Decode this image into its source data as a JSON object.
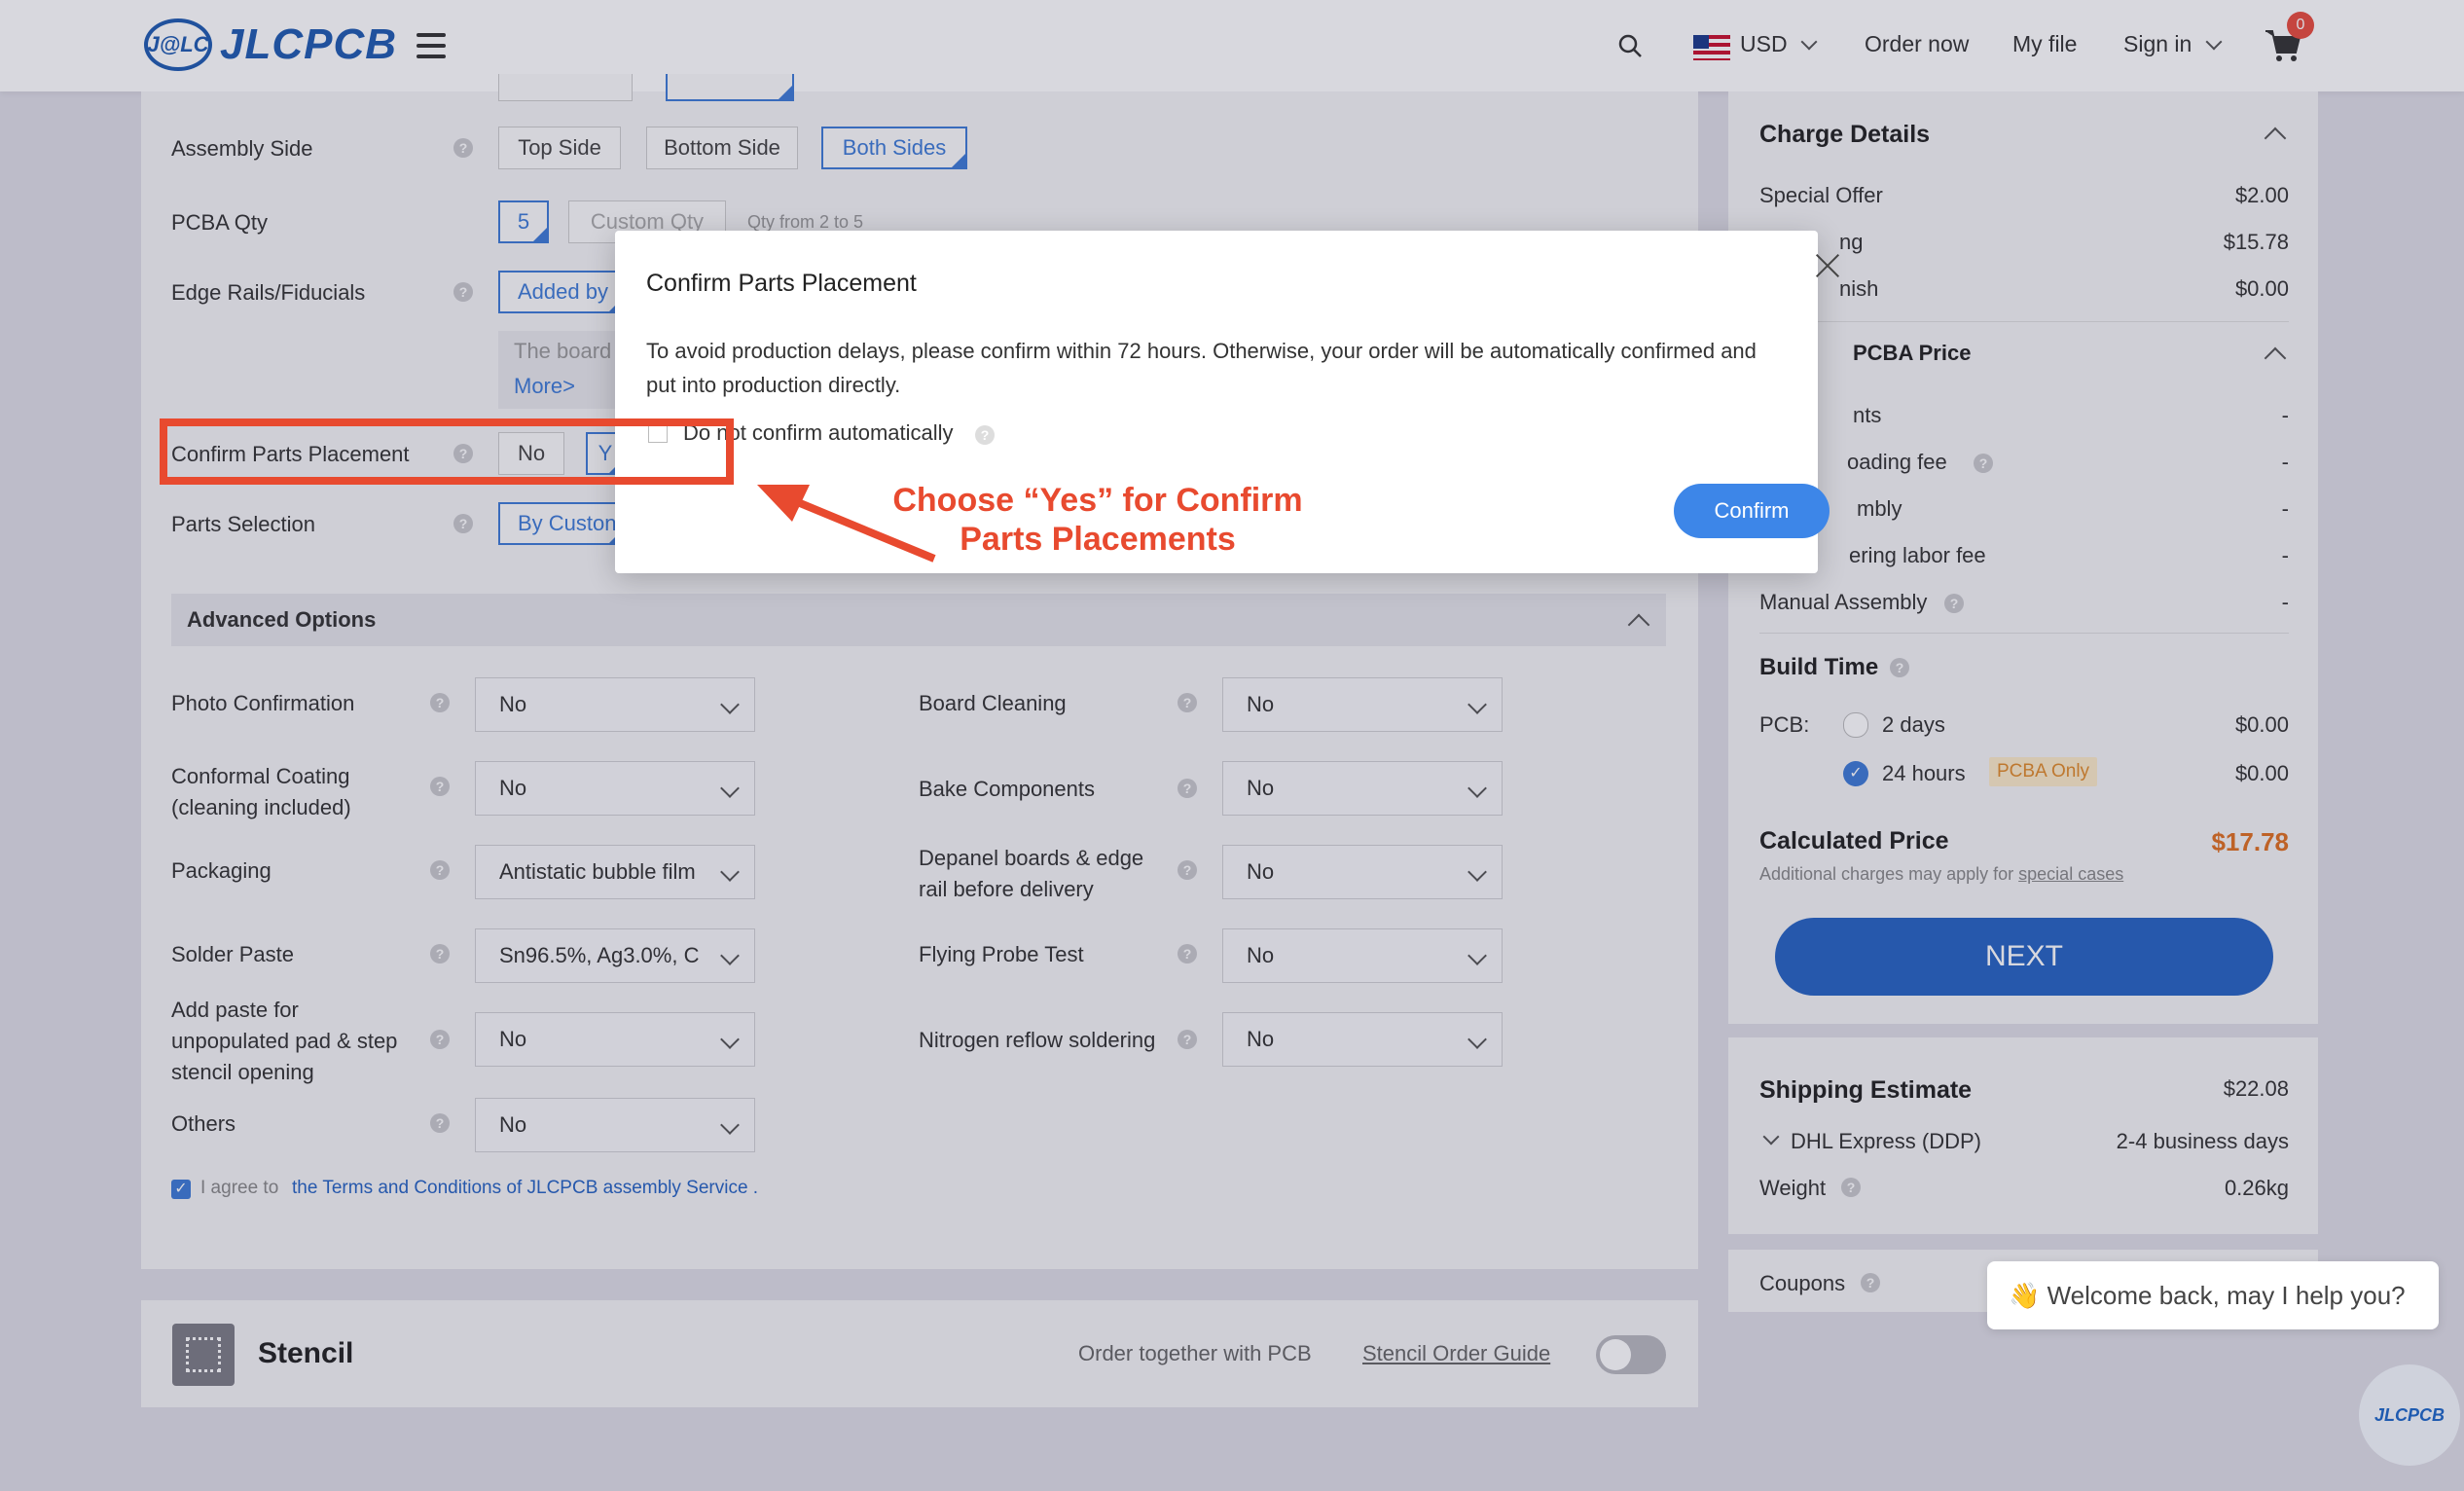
{
  "header": {
    "logo_mark": "J@LC",
    "logo_text": "JLCPCB",
    "currency": "USD",
    "order_now": "Order now",
    "my_file": "My file",
    "sign_in": "Sign in",
    "cart_count": "0"
  },
  "form": {
    "assembly_side": {
      "label": "Assembly Side",
      "options": [
        "Top Side",
        "Bottom Side",
        "Both Sides"
      ],
      "selected": "Both Sides"
    },
    "pcba_qty": {
      "label": "PCBA Qty",
      "value": "5",
      "custom_placeholder": "Custom Qty",
      "hint": "Qty from 2 to 5"
    },
    "edge_rails": {
      "label": "Edge Rails/Fiducials",
      "value": "Added by",
      "note": "The board",
      "more": "More>"
    },
    "confirm_parts": {
      "label": "Confirm Parts Placement",
      "options": [
        "No",
        "Y"
      ]
    },
    "parts_selection": {
      "label": "Parts Selection",
      "value": "By Custon"
    },
    "advanced_title": "Advanced Options",
    "advanced_left": [
      {
        "label": "Photo Confirmation",
        "value": "No"
      },
      {
        "label": "Conformal Coating (cleaning included)",
        "value": "No"
      },
      {
        "label": "Packaging",
        "value": "Antistatic bubble film"
      },
      {
        "label": "Solder Paste",
        "value": "Sn96.5%, Ag3.0%, C"
      },
      {
        "label": "Add paste for unpopulated pad & step stencil opening",
        "value": "No"
      },
      {
        "label": "Others",
        "value": "No"
      }
    ],
    "advanced_right": [
      {
        "label": "Board Cleaning",
        "value": "No"
      },
      {
        "label": "Bake Components",
        "value": "No"
      },
      {
        "label": "Depanel boards & edge rail before delivery",
        "value": "No"
      },
      {
        "label": "Flying Probe Test",
        "value": "No"
      },
      {
        "label": "Nitrogen reflow soldering",
        "value": "No"
      }
    ],
    "agree_text": "I agree to",
    "terms_link": "the Terms and Conditions of JLCPCB assembly Service ."
  },
  "stencil": {
    "title": "Stencil",
    "order_together": "Order together with PCB",
    "guide": "Stencil Order Guide"
  },
  "charges": {
    "title": "Charge Details",
    "rows": [
      {
        "label": "Special Offer",
        "value": "$2.00"
      },
      {
        "label": "ng",
        "value": "$15.78"
      },
      {
        "label": "nish",
        "value": "$0.00"
      }
    ],
    "pcba_title": "PCBA Price",
    "pcba_rows": [
      {
        "label": "nts",
        "value": "-"
      },
      {
        "label": "oading fee",
        "value": "-"
      },
      {
        "label": "mbly",
        "value": "-"
      },
      {
        "label": "ering labor fee",
        "value": "-"
      },
      {
        "label": "Manual Assembly",
        "value": "-"
      }
    ],
    "build_time_title": "Build Time",
    "pcb_label": "PCB:",
    "build_options": [
      {
        "label": "2 days",
        "value": "$0.00",
        "checked": false
      },
      {
        "label": "24 hours",
        "value": "$0.00",
        "checked": true,
        "tag": "PCBA Only"
      }
    ],
    "calc_label": "Calculated Price",
    "calc_value": "$17.78",
    "calc_note": "Additional charges may apply for",
    "calc_note_link": "special cases",
    "next": "NEXT"
  },
  "shipping": {
    "title": "Shipping Estimate",
    "value": "$22.08",
    "carrier": "DHL Express (DDP)",
    "days": "2-4 business days",
    "weight_label": "Weight",
    "weight_value": "0.26kg"
  },
  "coupons": {
    "label": "Coupons"
  },
  "chat": {
    "text": "👋 Welcome back, may I help you?",
    "badge": "JLCPCB"
  },
  "modal": {
    "title": "Confirm Parts Placement",
    "body": "To avoid production delays, please confirm within 72 hours. Otherwise, your order will be automatically confirmed and put into production directly.",
    "checkbox_label": "Do not confirm automatically",
    "confirm": "Confirm"
  },
  "annotation": {
    "text": "Choose “Yes” for Confirm Parts Placements",
    "color": "#e84a2f"
  },
  "colors": {
    "accent": "#3d7bd6",
    "next": "#2663c2",
    "price": "#e07020"
  }
}
